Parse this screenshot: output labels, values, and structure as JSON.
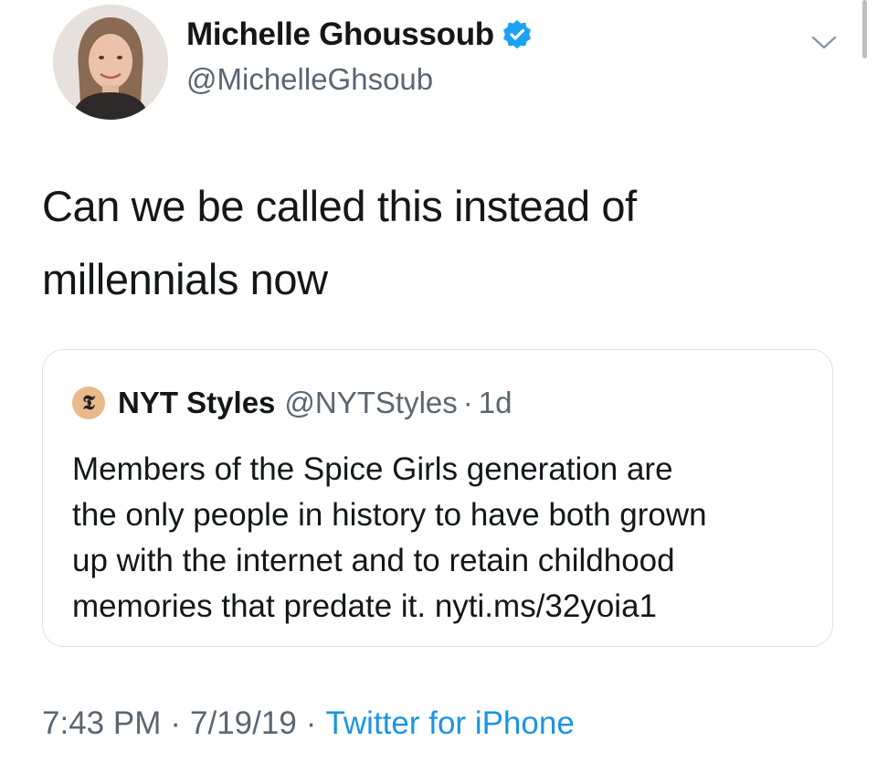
{
  "author": {
    "name": "Michelle Ghoussoub",
    "handle": "@MichelleGhsoub",
    "verified": true
  },
  "tweet": {
    "text_line1": "Can we be called this instead of",
    "text_line2": "millennials now"
  },
  "quoted_tweet": {
    "name": "NYT Styles",
    "handle": "@NYTStyles",
    "separator": "·",
    "age": "1d",
    "logo_glyph": "𝕿",
    "lines": [
      "Members of the Spice Girls generation are",
      "the only people in history to have both grown",
      "up with the internet and to retain childhood",
      "memories that predate it. nyti.ms/32yoia1"
    ]
  },
  "meta": {
    "time": "7:43 PM",
    "date": "7/19/19",
    "separator": "·",
    "source": "Twitter for iPhone"
  },
  "colors": {
    "text": "#14171a",
    "secondary": "#5b6670",
    "link": "#1b95e0",
    "verified": "#1da1f2",
    "border": "#dde2e6"
  },
  "icons": {
    "verified": "verified-badge-icon",
    "caret": "chevron-down-icon",
    "quoted_logo": "nyt-logo-icon"
  }
}
